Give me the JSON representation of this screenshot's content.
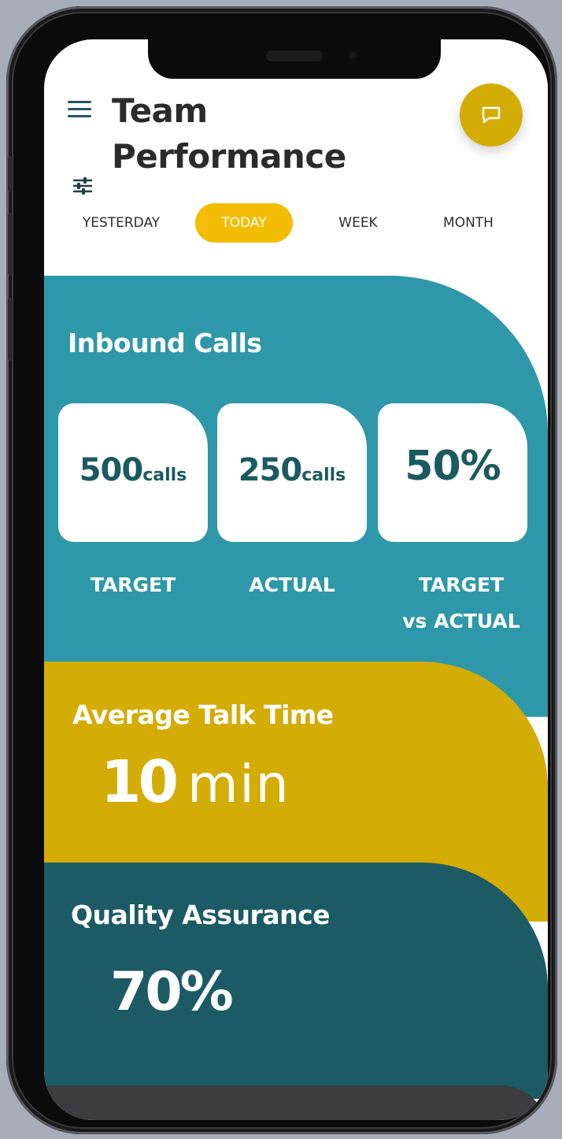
{
  "header": {
    "title": "Team Performance",
    "menu_icon": "hamburger-menu-icon",
    "filter_icon": "sliders-filter-icon",
    "chat_icon": "chat-bubble-icon"
  },
  "tabs": [
    {
      "label": "YESTERDAY",
      "active": false
    },
    {
      "label": "TODAY",
      "active": true
    },
    {
      "label": "WEEK",
      "active": false
    },
    {
      "label": "MONTH",
      "active": false
    }
  ],
  "inbound": {
    "title": "Inbound Calls",
    "target": {
      "value": "500",
      "unit": "calls",
      "label": "TARGET"
    },
    "actual": {
      "value": "250",
      "unit": "calls",
      "label": "ACTUAL"
    },
    "ratio": {
      "value": "50%",
      "label_line1": "TARGET",
      "label_line2": "vs ACTUAL"
    }
  },
  "talk_time": {
    "title": "Average Talk Time",
    "value": "10",
    "unit": "min"
  },
  "quality": {
    "title": "Quality Assurance",
    "value": "70%"
  },
  "colors": {
    "teal": "#2e98aa",
    "gold": "#d4ac06",
    "dark_teal": "#1c5b65",
    "tab_active": "#f3bd06",
    "text_dark": "#1a5a61"
  }
}
